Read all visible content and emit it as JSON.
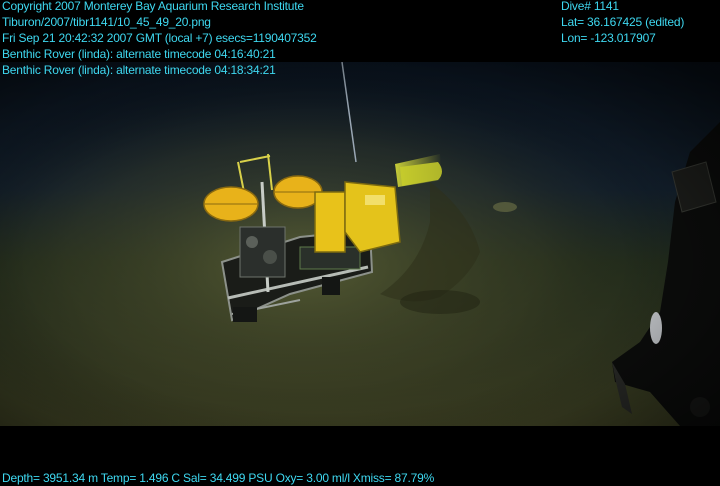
{
  "overlay": {
    "copyright": "Copyright 2007 Monterey Bay Aquarium Research Institute",
    "filename": "Tiburon/2007/tibr1141/10_45_49_20.png",
    "datetime": "Fri Sep 21 20:42:32 2007 GMT (local +7)  esecs=1190407352",
    "timecode_1": "Benthic Rover (linda): alternate timecode 04:16:40:21",
    "timecode_2": "Benthic Rover (linda): alternate timecode 04:18:34:21",
    "dive": "Dive# 1141",
    "lat": "Lat= 36.167425 (edited)",
    "lon": "Lon= -123.017907",
    "sensors": "Depth= 3951.34 m  Temp= 1.496 C  Sal= 34.499 PSU  Oxy= 3.00 ml/l  Xmiss= 87.79%"
  },
  "colors": {
    "overlay_text": "#3ed8f0",
    "seafloor": "#3a3c22",
    "water": "#0d1a2a",
    "rover_yellow": "#e8c21a"
  },
  "scene": {
    "subject": "benthic-rover",
    "tool": "rov-manipulator"
  }
}
